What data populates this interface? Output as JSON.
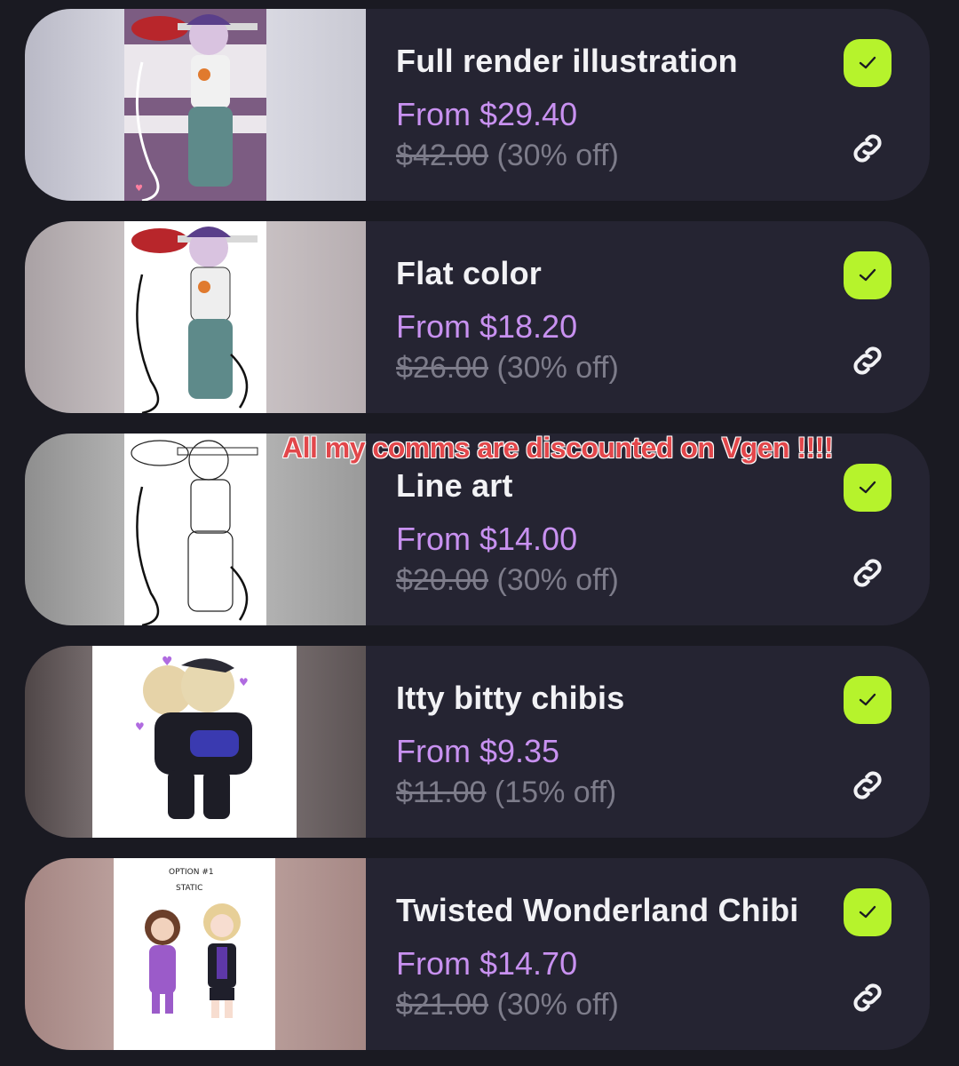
{
  "overlay_caption": "All my comms are discounted on Vgen !!!!",
  "accent_colors": {
    "card_bg": "#252432",
    "price": "#c891f0",
    "check_bg": "#b6f32c",
    "strike_text": "#7d7c8a"
  },
  "items": [
    {
      "title": "Full render illustration",
      "price": "From $29.40",
      "original_price": "$42.00",
      "discount": "(30% off)",
      "selected_icon": "check-icon",
      "link_icon": "link-icon"
    },
    {
      "title": "Flat color",
      "price": "From $18.20",
      "original_price": "$26.00",
      "discount": "(30% off)",
      "selected_icon": "check-icon",
      "link_icon": "link-icon"
    },
    {
      "title": "Line art",
      "price": "From $14.00",
      "original_price": "$20.00",
      "discount": "(30% off)",
      "selected_icon": "check-icon",
      "link_icon": "link-icon"
    },
    {
      "title": "Itty bitty chibis",
      "price": "From $9.35",
      "original_price": "$11.00",
      "discount": "(15% off)",
      "selected_icon": "check-icon",
      "link_icon": "link-icon"
    },
    {
      "title": "Twisted Wonderland Chibi",
      "price": "From $14.70",
      "original_price": "$21.00",
      "discount": "(30% off)",
      "selected_icon": "check-icon",
      "link_icon": "link-icon",
      "thumbnail_text": [
        "OPTION #1",
        "STATIC"
      ]
    }
  ]
}
